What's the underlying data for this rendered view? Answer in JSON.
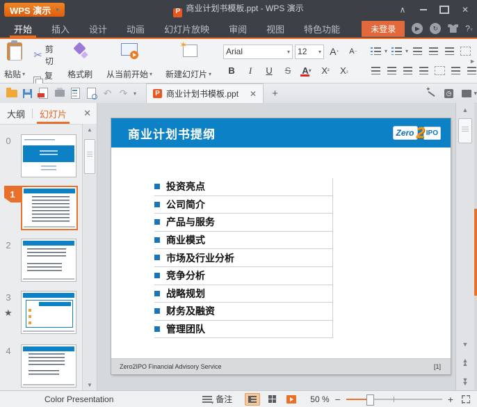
{
  "colors": {
    "accent_orange": "#EC6C1F",
    "titlebar_dark": "#3D4147",
    "slide_blue": "#0D81C6",
    "bullet_blue": "#1C74B8",
    "login_button_bg": "#E2693C",
    "selection_orange": "#E8702A"
  },
  "titlebar": {
    "app_button_label": "WPS 演示",
    "document_title": "商业计划书模板.ppt - WPS 演示"
  },
  "ribbon_tabs": [
    {
      "label": "开始",
      "active": true
    },
    {
      "label": "插入",
      "active": false
    },
    {
      "label": "设计",
      "active": false
    },
    {
      "label": "动画",
      "active": false
    },
    {
      "label": "幻灯片放映",
      "active": false
    },
    {
      "label": "审阅",
      "active": false
    },
    {
      "label": "视图",
      "active": false
    },
    {
      "label": "特色功能",
      "active": false
    }
  ],
  "tab_right": {
    "login_button": "未登录",
    "help_label": "?"
  },
  "ribbon": {
    "paste_label": "粘贴",
    "cut_label": "剪切",
    "copy_label": "复制",
    "format_painter_label": "格式刷",
    "from_current_label": "从当前开始",
    "new_slide_label": "新建幻灯片",
    "font_family_value": "Arial",
    "font_size_value": "12",
    "bold_label": "B",
    "italic_label": "I",
    "underline_label": "U",
    "strikethrough_label": "S",
    "font_color_label": "A",
    "grow_font_label": "A",
    "shrink_font_label": "A",
    "superscript_label": "X",
    "subscript_label": "X"
  },
  "doc_tab": {
    "active_title": "商业计划书模板.ppt"
  },
  "left_panel": {
    "tab_outline": "大纲",
    "tab_slides": "幻灯片",
    "slides": [
      {
        "num": "0",
        "variant": "title",
        "selected": false,
        "starred": false
      },
      {
        "num": "1",
        "variant": "outline",
        "selected": true,
        "starred": false
      },
      {
        "num": "2",
        "variant": "content",
        "selected": false,
        "starred": false
      },
      {
        "num": "3",
        "variant": "highlight",
        "selected": false,
        "starred": true
      },
      {
        "num": "4",
        "variant": "content2",
        "selected": false,
        "starred": false
      }
    ]
  },
  "slide": {
    "title": "商业计划书提纲",
    "logo_zero": "Zero",
    "logo_two": "2",
    "logo_ipo": "IPO",
    "bullets": [
      "投资亮点",
      "公司简介",
      "产品与服务",
      "商业模式",
      "市场及行业分析",
      "竞争分析",
      "战略规划",
      "财务及融资",
      "管理团队"
    ],
    "footer_left": "Zero2IPO Financial Advisory Service",
    "footer_right": "[1]"
  },
  "status_bar": {
    "theme_name": "Color Presentation",
    "notes_label": "备注",
    "zoom_value": "50 %"
  },
  "icons": {
    "cut": "✂",
    "undo": "↶",
    "redo": "↷",
    "caret_down": "▾",
    "close": "✕",
    "tab_close": "✕",
    "new_tab_plus": "+",
    "up_arrow": "▲",
    "down_arrow": "▼",
    "double_up": "▲▲",
    "double_down": "▼▼",
    "right_arrow": "►",
    "minus": "−",
    "plus": "+",
    "collapse": "∧",
    "ppt_file": "P",
    "wps_flag": "⚑",
    "clock": "◷",
    "play_circle": "▶",
    "refresh_circle": "↻",
    "superscript_mark": "²",
    "subscript_mark": "₂",
    "grow_mark": "⁺",
    "shrink_mark": "⁻",
    "star": "★"
  }
}
